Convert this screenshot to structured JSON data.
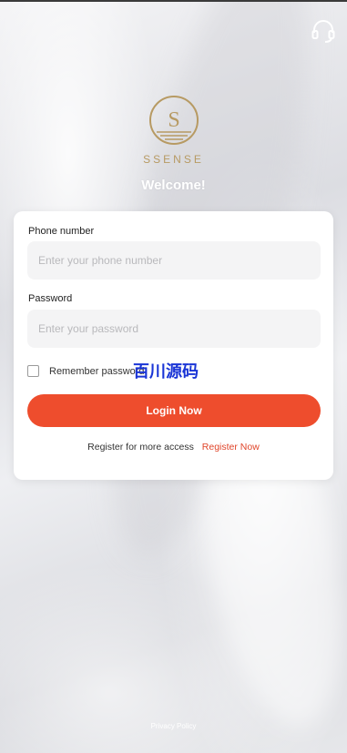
{
  "app": {
    "brand": "SSENSE",
    "welcome": "Welcome!"
  },
  "header": {
    "support_icon": "headset-icon"
  },
  "form": {
    "phone": {
      "label": "Phone number",
      "placeholder": "Enter your phone number",
      "value": ""
    },
    "password": {
      "label": "Password",
      "placeholder": "Enter your password",
      "value": ""
    },
    "remember_label": "Remember password",
    "remember_checked": false,
    "watermark": "百川源码",
    "login_label": "Login Now",
    "register_prompt": "Register for more access",
    "register_link": "Register Now"
  },
  "footer": {
    "privacy": "Privacy Policy"
  },
  "colors": {
    "accent": "#ee4d2d",
    "link": "#e0452a",
    "gold": "#b79a63",
    "watermark": "#1a35d6"
  }
}
